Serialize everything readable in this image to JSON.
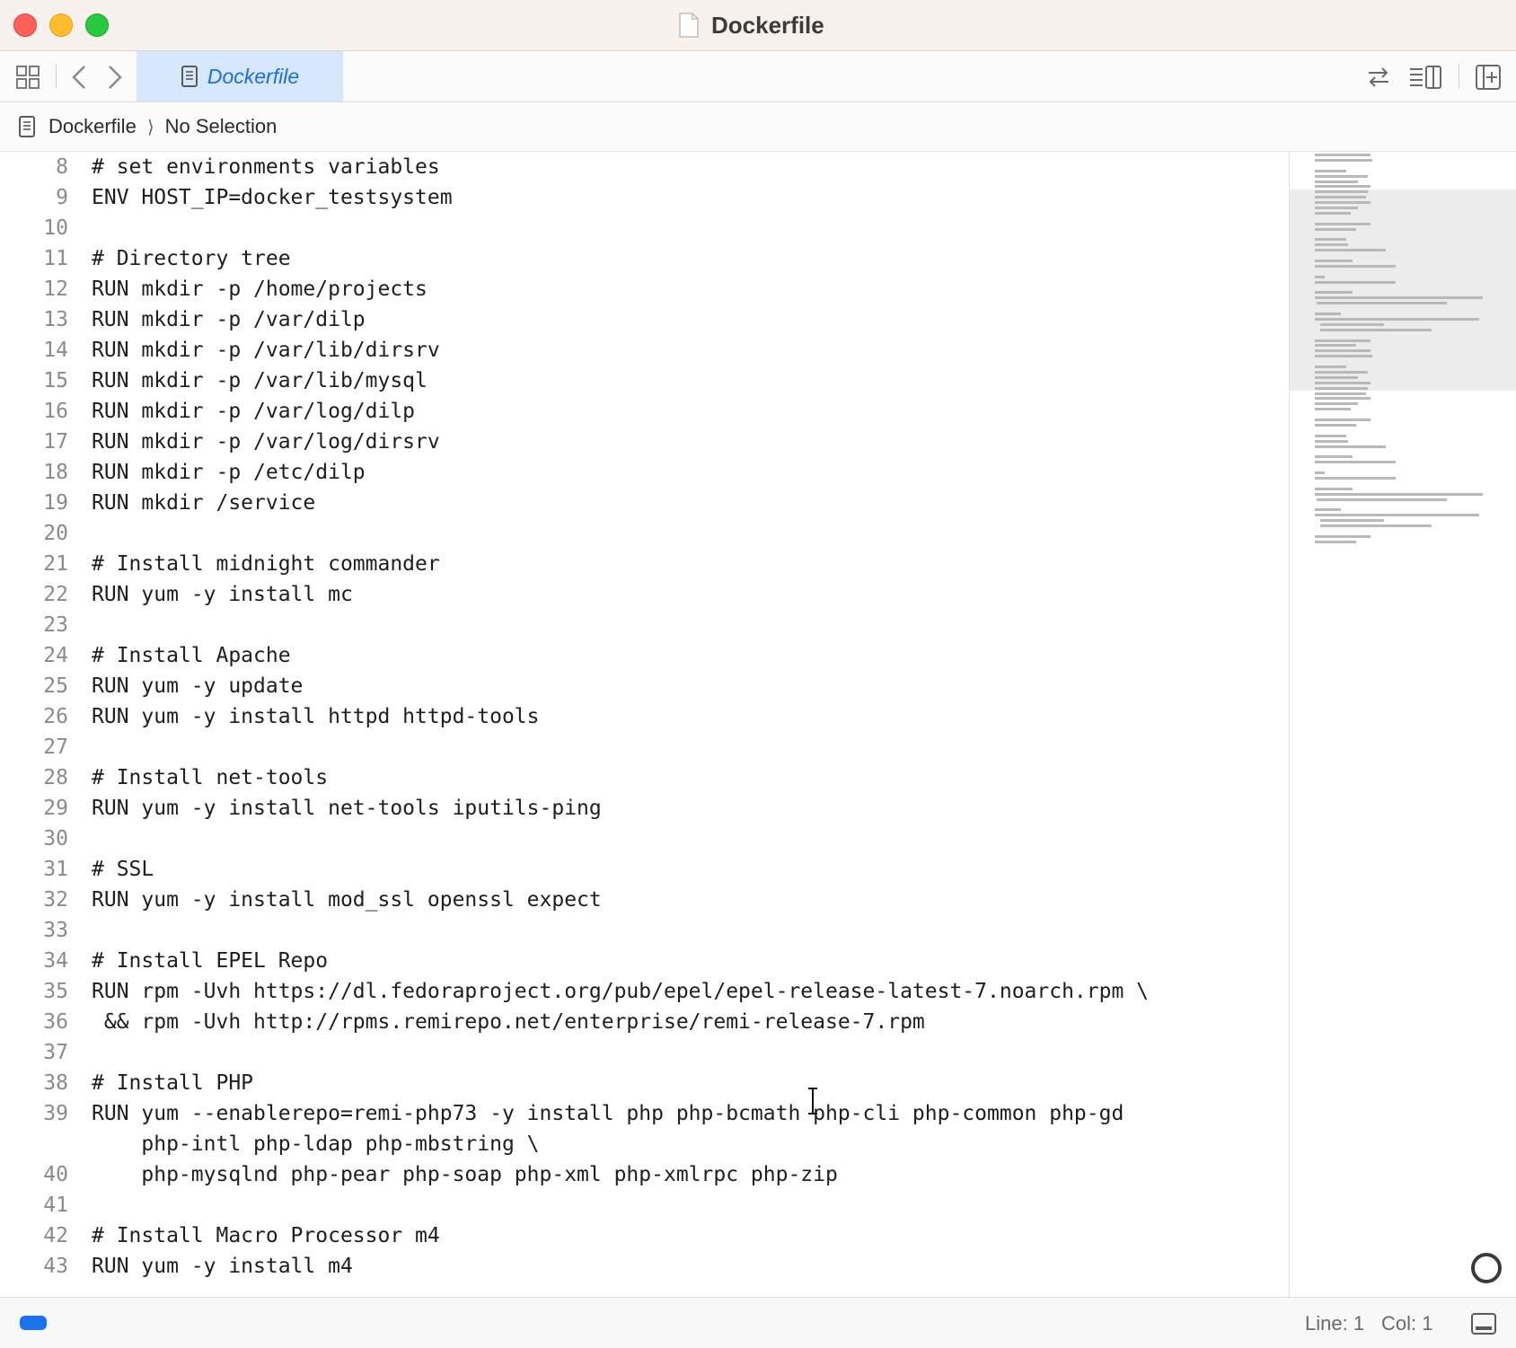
{
  "window": {
    "title": "Dockerfile"
  },
  "toolbar": {
    "tab_label": "Dockerfile"
  },
  "pathbar": {
    "file": "Dockerfile",
    "selection": "No Selection"
  },
  "editor": {
    "lines": [
      {
        "n": "8",
        "text": "# set environments variables"
      },
      {
        "n": "9",
        "text": "ENV HOST_IP=docker_testsystem"
      },
      {
        "n": "10",
        "text": ""
      },
      {
        "n": "11",
        "text": "# Directory tree"
      },
      {
        "n": "12",
        "text": "RUN mkdir -p /home/projects"
      },
      {
        "n": "13",
        "text": "RUN mkdir -p /var/dilp"
      },
      {
        "n": "14",
        "text": "RUN mkdir -p /var/lib/dirsrv"
      },
      {
        "n": "15",
        "text": "RUN mkdir -p /var/lib/mysql"
      },
      {
        "n": "16",
        "text": "RUN mkdir -p /var/log/dilp"
      },
      {
        "n": "17",
        "text": "RUN mkdir -p /var/log/dirsrv"
      },
      {
        "n": "18",
        "text": "RUN mkdir -p /etc/dilp"
      },
      {
        "n": "19",
        "text": "RUN mkdir /service"
      },
      {
        "n": "20",
        "text": ""
      },
      {
        "n": "21",
        "text": "# Install midnight commander"
      },
      {
        "n": "22",
        "text": "RUN yum -y install mc"
      },
      {
        "n": "23",
        "text": ""
      },
      {
        "n": "24",
        "text": "# Install Apache"
      },
      {
        "n": "25",
        "text": "RUN yum -y update"
      },
      {
        "n": "26",
        "text": "RUN yum -y install httpd httpd-tools"
      },
      {
        "n": "27",
        "text": ""
      },
      {
        "n": "28",
        "text": "# Install net-tools"
      },
      {
        "n": "29",
        "text": "RUN yum -y install net-tools iputils-ping"
      },
      {
        "n": "30",
        "text": ""
      },
      {
        "n": "31",
        "text": "# SSL"
      },
      {
        "n": "32",
        "text": "RUN yum -y install mod_ssl openssl expect"
      },
      {
        "n": "33",
        "text": ""
      },
      {
        "n": "34",
        "text": "# Install EPEL Repo"
      },
      {
        "n": "35",
        "text": "RUN rpm -Uvh https://dl.fedoraproject.org/pub/epel/epel-release-latest-7.noarch.rpm \\"
      },
      {
        "n": "36",
        "text": " && rpm -Uvh http://rpms.remirepo.net/enterprise/remi-release-7.rpm"
      },
      {
        "n": "37",
        "text": ""
      },
      {
        "n": "38",
        "text": "# Install PHP"
      },
      {
        "n": "39",
        "text": "RUN yum --enablerepo=remi-php73 -y install php php-bcmath php-cli php-common php-gd"
      },
      {
        "n": "",
        "text": "    php-intl php-ldap php-mbstring \\"
      },
      {
        "n": "40",
        "text": "    php-mysqlnd php-pear php-soap php-xml php-xmlrpc php-zip"
      },
      {
        "n": "41",
        "text": ""
      },
      {
        "n": "42",
        "text": "# Install Macro Processor m4"
      },
      {
        "n": "43",
        "text": "RUN yum -y install m4"
      }
    ]
  },
  "statusbar": {
    "line": "Line: 1",
    "col": "Col: 1"
  },
  "icons": {
    "close": "close-dot",
    "minimize": "minimize-dot",
    "zoom": "zoom-dot",
    "grid": "grid-icon",
    "back": "chevron-left-icon",
    "forward": "chevron-right-icon",
    "swap": "swap-arrows-icon",
    "inspector": "inspector-icon",
    "add_editor": "add-editor-icon"
  },
  "colors": {
    "accent": "#1a73e8",
    "tab_bg": "#d6e6fb",
    "tab_text": "#1f6fd6",
    "titlebar": "#f6f1ec"
  }
}
